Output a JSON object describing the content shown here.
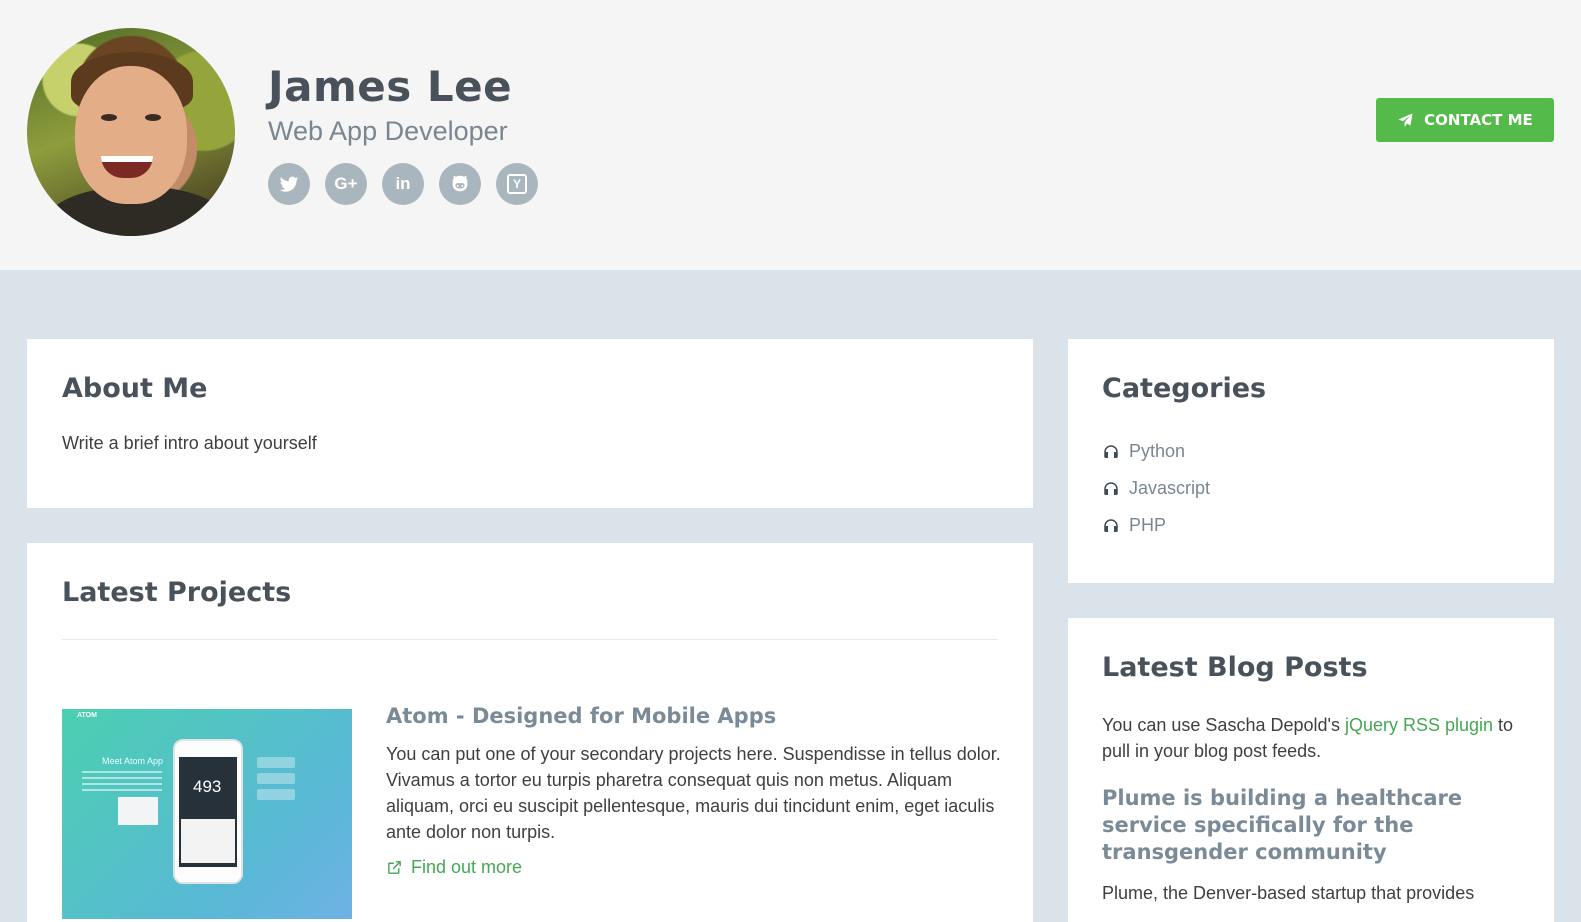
{
  "profile": {
    "name": "James Lee",
    "tagline": "Web App Developer",
    "social": [
      {
        "icon": "twitter-icon"
      },
      {
        "icon": "google-plus-icon",
        "text": "G+"
      },
      {
        "icon": "linkedin-icon",
        "text": "in"
      },
      {
        "icon": "github-icon"
      },
      {
        "icon": "hacker-news-icon",
        "text": "Y"
      }
    ],
    "contact_label": "CONTACT ME"
  },
  "about": {
    "title": "About Me",
    "text": "Write a brief intro about yourself"
  },
  "projects": {
    "title": "Latest Projects",
    "items": [
      {
        "thumb_logo": "ATOM",
        "thumb_heading": "Meet Atom App",
        "thumb_number": "493",
        "title": "Atom - Designed for Mobile Apps",
        "description": "You can put one of your secondary projects here. Suspendisse in tellus dolor. Vivamus a tortor eu turpis pharetra consequat quis non metus. Aliquam aliquam, orci eu suscipit pellentesque, mauris dui tincidunt enim, eget iaculis ante dolor non turpis.",
        "link_label": "Find out more"
      }
    ]
  },
  "categories": {
    "title": "Categories",
    "items": [
      "Python",
      "Javascript",
      "PHP"
    ]
  },
  "blog": {
    "title": "Latest Blog Posts",
    "intro_before": "You can use Sascha Depold's ",
    "intro_link": "jQuery RSS plugin",
    "intro_after": " to pull in your blog post feeds.",
    "post_title": "Plume is building a healthcare service specifically for the transgender community",
    "post_excerpt": "Plume, the Denver-based startup that provides"
  },
  "colors": {
    "accent_green": "#54ba4a",
    "link_green": "#44a853",
    "page_bg": "#dae3e9",
    "header_bg": "#f5f5f5",
    "heading": "#49515a"
  }
}
